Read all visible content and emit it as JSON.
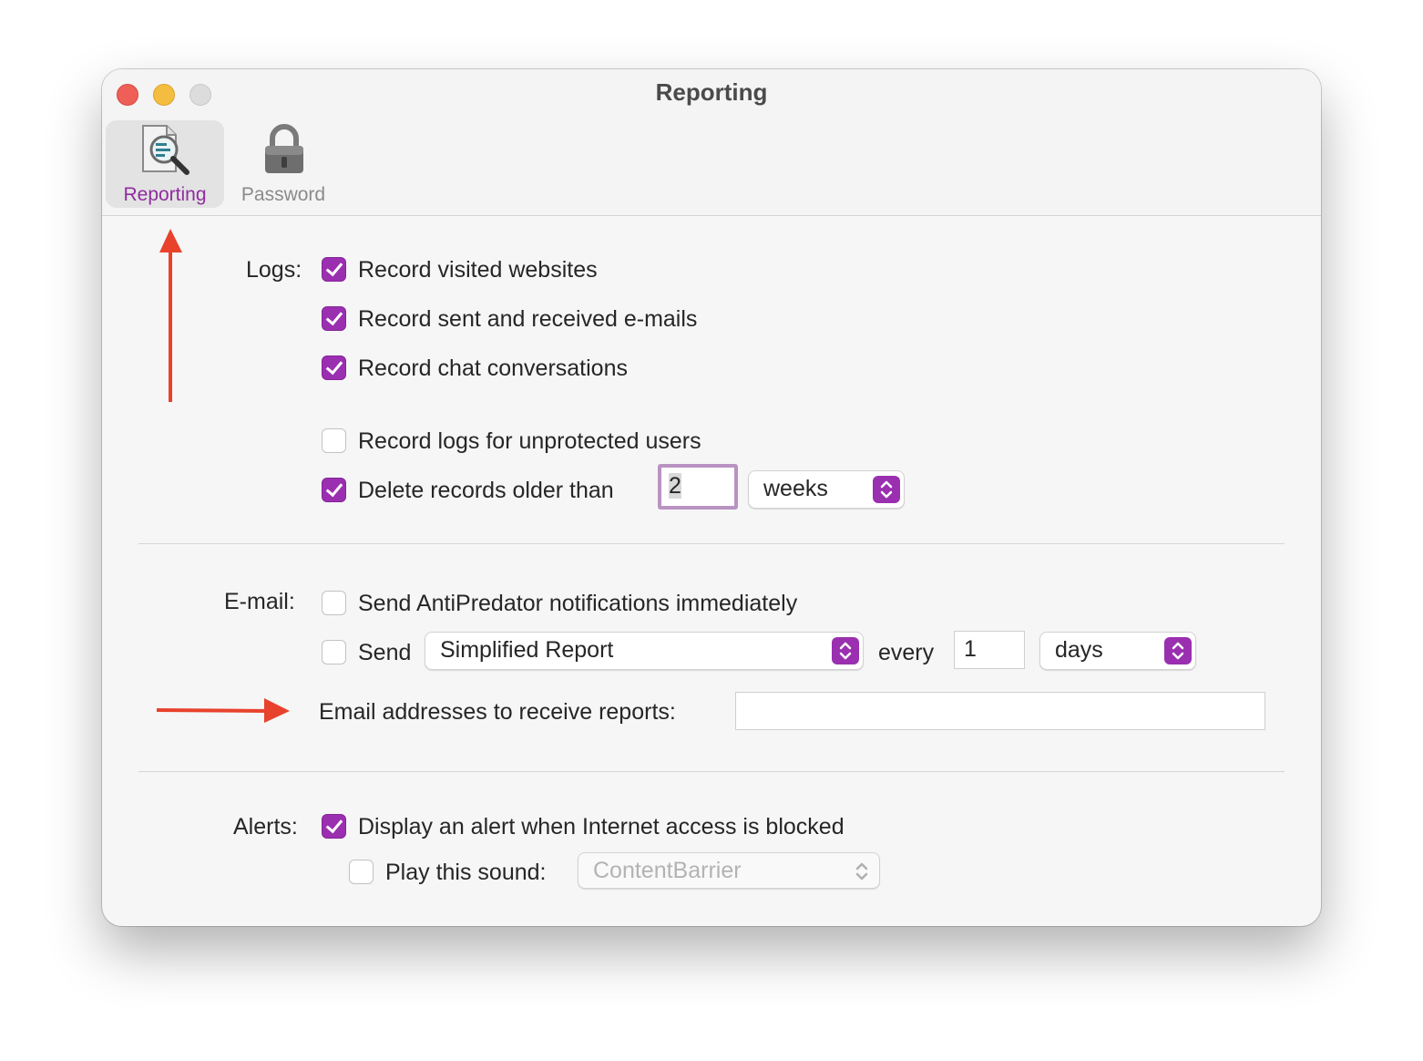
{
  "window": {
    "title": "Reporting"
  },
  "toolbar": {
    "items": [
      {
        "label": "Reporting",
        "icon": "magnifier-document-icon",
        "active": true
      },
      {
        "label": "Password",
        "icon": "lock-icon",
        "active": false
      }
    ]
  },
  "logs": {
    "section_label": "Logs:",
    "record_websites": {
      "label": "Record visited websites",
      "checked": true
    },
    "record_emails": {
      "label": "Record sent and received e-mails",
      "checked": true
    },
    "record_chat": {
      "label": "Record chat conversations",
      "checked": true
    },
    "record_unprotected": {
      "label": "Record logs for unprotected users",
      "checked": false
    },
    "delete_records": {
      "label": "Delete records older than",
      "checked": true,
      "value": "2",
      "unit": "weeks"
    }
  },
  "email": {
    "section_label": "E-mail:",
    "send_notifications": {
      "label": "Send AntiPredator notifications immediately",
      "checked": false
    },
    "send_report": {
      "label": "Send",
      "checked": false,
      "report_type": "Simplified Report",
      "every_label": "every",
      "interval": "1",
      "interval_unit": "days"
    },
    "addresses": {
      "label": "Email addresses to receive reports:",
      "value": ""
    }
  },
  "alerts": {
    "section_label": "Alerts:",
    "display_alert": {
      "label": "Display an alert when Internet access is blocked",
      "checked": true
    },
    "play_sound": {
      "label": "Play this sound:",
      "checked": false,
      "sound": "ContentBarrier"
    }
  },
  "colors": {
    "accent": "#9a2fb0",
    "annotation_arrow": "#e8422c"
  }
}
